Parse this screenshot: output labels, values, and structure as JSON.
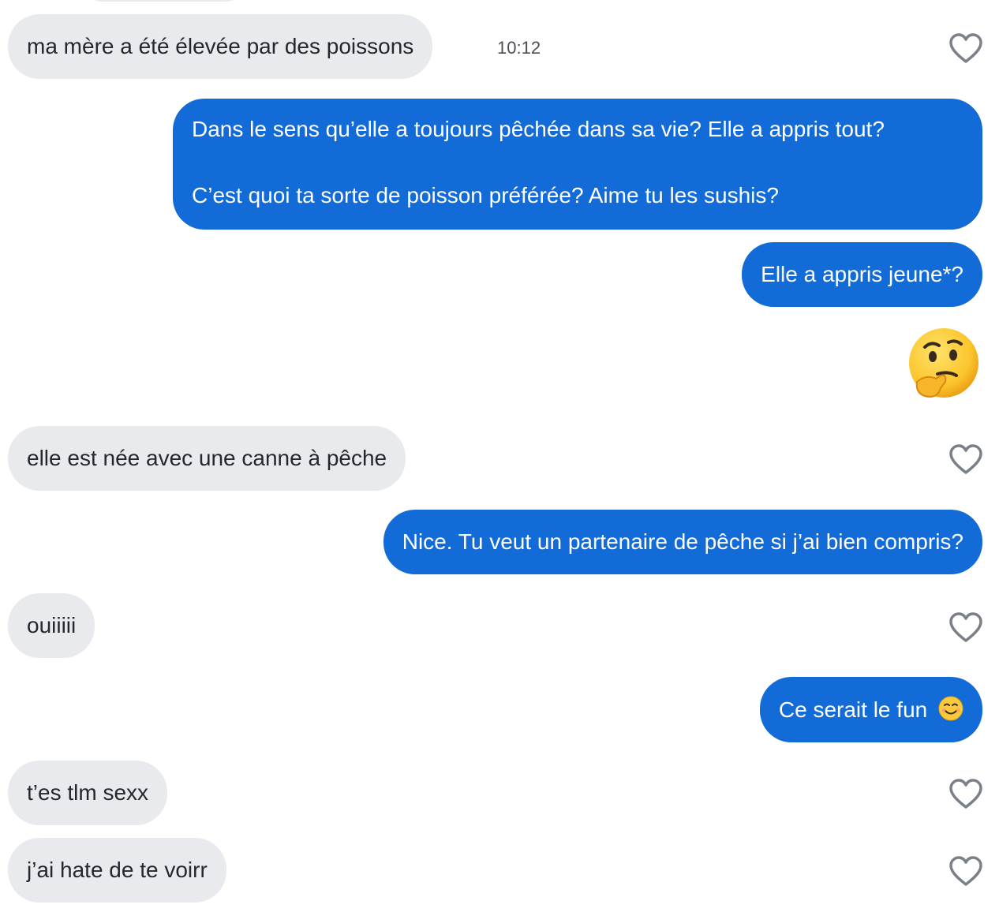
{
  "timestamp": "10:12",
  "messages": [
    {
      "id": "m1",
      "side": "in",
      "text": "ma mère a été élevée par des poissons",
      "liked": false
    },
    {
      "id": "m2",
      "side": "out",
      "lines": [
        "Dans le sens qu’elle a toujours pêchée dans sa vie? Elle a appris tout?",
        "C’est quoi ta sorte de poisson préférée? Aime tu les sushis?"
      ]
    },
    {
      "id": "m3",
      "side": "out",
      "text": "Elle a appris jeune*?"
    },
    {
      "id": "m4",
      "side": "out",
      "emoji": "thinking-face"
    },
    {
      "id": "m5",
      "side": "in",
      "text": "elle est née avec une canne à pêche",
      "liked": false
    },
    {
      "id": "m6",
      "side": "out",
      "text": "Nice. Tu veut un partenaire de pêche si j’ai bien compris?"
    },
    {
      "id": "m7",
      "side": "in",
      "text": "ouiiiii",
      "liked": false
    },
    {
      "id": "m8",
      "side": "out",
      "text": "Ce serait le fun",
      "emoji": "smiling-face"
    },
    {
      "id": "m9",
      "side": "in",
      "text": "t’es tlm sexx",
      "liked": false
    },
    {
      "id": "m10",
      "side": "in",
      "text": "j’ai hate de te voirr",
      "liked": false
    }
  ],
  "colors": {
    "incoming_bubble": "#e9eaed",
    "outgoing_bubble": "#126bd6",
    "heart_outline": "#7b8088"
  }
}
